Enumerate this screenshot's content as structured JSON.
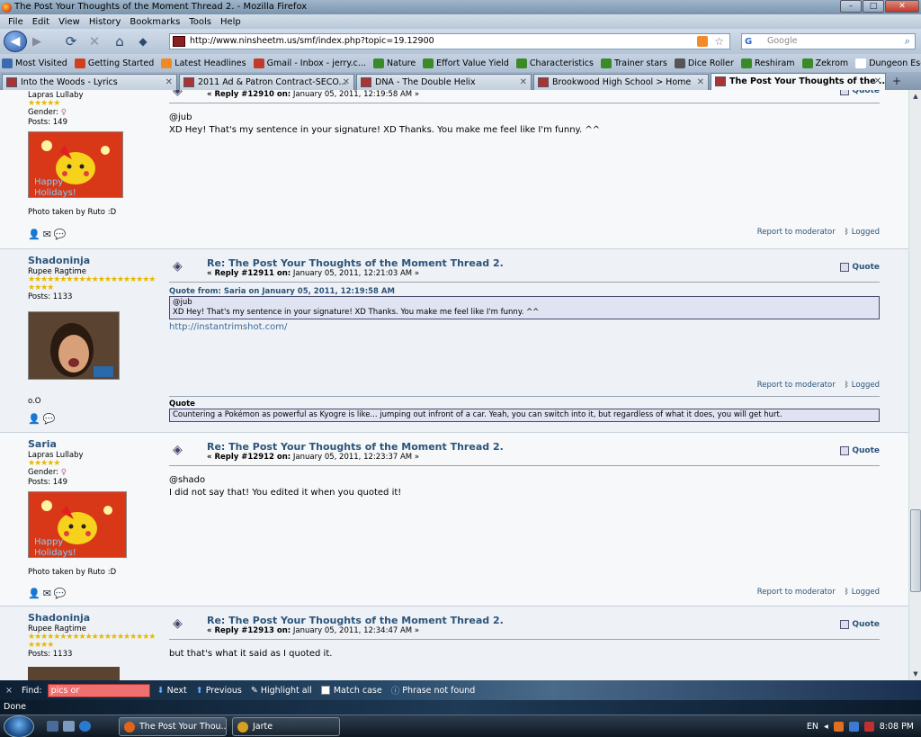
{
  "window": {
    "title": "The Post Your Thoughts of the Moment Thread 2. - Mozilla Firefox"
  },
  "menu": [
    "File",
    "Edit",
    "View",
    "History",
    "Bookmarks",
    "Tools",
    "Help"
  ],
  "nav": {
    "url": "http://www.ninsheetm.us/smf/index.php?topic=19.12900",
    "search_placeholder": "Google",
    "search_logo": "G"
  },
  "bookmarks": [
    {
      "label": "Most Visited",
      "color": "#3a6ab0"
    },
    {
      "label": "Getting Started",
      "color": "#d04020"
    },
    {
      "label": "Latest Headlines",
      "color": "#f08a24"
    },
    {
      "label": "Gmail - Inbox - jerry.c...",
      "color": "#c0392b"
    },
    {
      "label": "Nature",
      "color": "#3a8a2a"
    },
    {
      "label": "Effort Value Yield",
      "color": "#3a8a2a"
    },
    {
      "label": "Characteristics",
      "color": "#3a8a2a"
    },
    {
      "label": "Trainer stars",
      "color": "#3a8a2a"
    },
    {
      "label": "Dice Roller",
      "color": "#555555"
    },
    {
      "label": "Reshiram",
      "color": "#3a8a2a"
    },
    {
      "label": "Zekrom",
      "color": "#3a8a2a"
    },
    {
      "label": "Dungeon Escape!",
      "color": "#ffffff"
    }
  ],
  "tabs": [
    {
      "label": "Into the Woods - Lyrics",
      "active": false
    },
    {
      "label": "2011 Ad & Patron Contract-SECO...",
      "active": false
    },
    {
      "label": "DNA - The Double Helix",
      "active": false
    },
    {
      "label": "Brookwood High School > Home",
      "active": false
    },
    {
      "label": "The Post Your Thoughts of the ...",
      "active": true
    }
  ],
  "forum": {
    "quote_label": "Quote",
    "report_label": "Report to moderator",
    "logged_label": "Logged",
    "posts": [
      {
        "name": "",
        "rank": "Lapras Lullaby",
        "gender": "Gender:",
        "gender_symbol": "♀",
        "posts": "Posts: 149",
        "stars": "★★★★★",
        "signature": "Photo taken by Ruto :D",
        "meta_prefix": "« Reply #12910 on:",
        "meta_date": " January 05, 2011, 12:19:58 AM »",
        "lines": [
          "@jub",
          "XD Hey! That's my sentence in your signature! XD Thanks. You make me feel like I'm funny. ^^"
        ]
      },
      {
        "name": "Shadoninja",
        "rank": "Rupee Ragtime",
        "posts": "Posts: 1133",
        "stars": "★★★★★★★★★★★★★★★★★★★★★★★★",
        "subject": "Re: The Post Your Thoughts of the Moment Thread 2.",
        "meta_prefix": "« Reply #12911 on:",
        "meta_date": " January 05, 2011, 12:21:03 AM »",
        "quote_header": "Quote from: Saria on January 05, 2011, 12:19:58 AM",
        "quote_lines": [
          "@jub",
          "XD Hey! That's my sentence in your signature! XD Thanks. You make me feel like I'm funny. ^^"
        ],
        "link": "http://instantrimshot.com/",
        "avatar_caption": "o.O",
        "sig_quote_label": "Quote",
        "sig_quote_text": "Countering a Pokémon as powerful as Kyogre is like... jumping out infront of a car. Yeah, you can switch into it, but regardless of what it does, you will get hurt."
      },
      {
        "name": "Saria",
        "rank": "Lapras Lullaby",
        "gender": "Gender:",
        "gender_symbol": "♀",
        "posts": "Posts: 149",
        "stars": "★★★★★",
        "subject": "Re: The Post Your Thoughts of the Moment Thread 2.",
        "meta_prefix": "« Reply #12912 on:",
        "meta_date": " January 05, 2011, 12:23:37 AM »",
        "lines": [
          "@shado",
          "I did not say that! You edited it when you quoted it!"
        ],
        "signature": "Photo taken by Ruto :D"
      },
      {
        "name": "Shadoninja",
        "rank": "Rupee Ragtime",
        "posts": "Posts: 1133",
        "stars": "★★★★★★★★★★★★★★★★★★★★★★★★",
        "subject": "Re: The Post Your Thoughts of the Moment Thread 2.",
        "meta_prefix": "« Reply #12913 on:",
        "meta_date": " January 05, 2011, 12:34:47 AM »",
        "lines": [
          "but that's what it said as I quoted it."
        ]
      }
    ],
    "avatar_text": [
      "Happy",
      "Holidays!"
    ]
  },
  "findbar": {
    "close": "×",
    "label": "Find:",
    "value": "pics or",
    "next": "Next",
    "previous": "Previous",
    "highlight": "Highlight all",
    "match_case": "Match case",
    "status": "Phrase not found"
  },
  "status": "Done",
  "taskbar": {
    "items": [
      {
        "label": "The Post Your Thou...",
        "color": "#e0641a"
      },
      {
        "label": "Jarte",
        "color": "#d8a020"
      }
    ],
    "lang": "EN",
    "time": "8:08 PM"
  }
}
